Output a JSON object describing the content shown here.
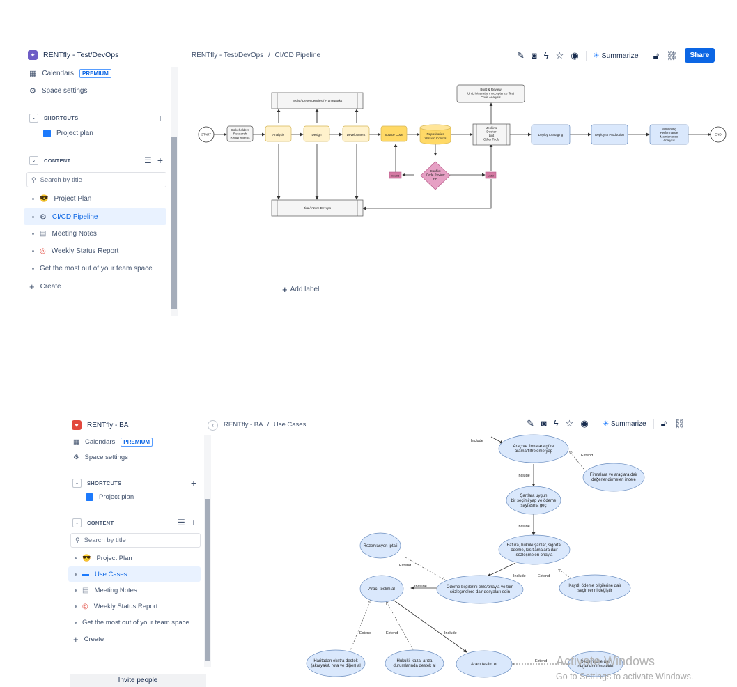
{
  "top": {
    "space_title": "RENTfly - Test/DevOps",
    "sidebar": {
      "calendars": "Calendars",
      "premium": "PREMIUM",
      "space_settings": "Space settings",
      "shortcuts": "SHORTCUTS",
      "project_plan_shortcut": "Project plan",
      "content": "CONTENT",
      "search_placeholder": "Search by title",
      "items": [
        "Project Plan",
        "CI/CD Pipeline",
        "Meeting Notes",
        "Weekly Status Report",
        "Get the most out of your team space"
      ],
      "create": "Create"
    },
    "breadcrumb": {
      "space": "RENTfly - Test/DevOps",
      "sep": "/",
      "page": "CI/CD Pipeline"
    },
    "toolbar": {
      "summarize": "Summarize",
      "share": "Share"
    },
    "add_label": "Add label",
    "diagram": {
      "start": "START",
      "end": "END",
      "stakeholders": [
        "Stakeholders",
        "Research",
        "Requirements"
      ],
      "analysis": "Analysis",
      "design": "Design",
      "development": "Development",
      "source_code": "Source Code",
      "repositories": [
        "Repositories",
        "Version Control"
      ],
      "jenkins": [
        "Jenkins",
        "Docker",
        "Lint",
        "Other Tools"
      ],
      "deploy_staging": "Deploy to Staging",
      "deploy_production": "Deploy to Production",
      "monitoring": [
        "Monitoring",
        "Performance",
        "Maintenance",
        "Analysis"
      ],
      "tools": "Tools / Dependencies / Frameworks",
      "jira": "Jira / Azure Devops",
      "build_review": [
        "Build & Review",
        "Unit, Integration, Acceptance Test",
        "Code Analysis"
      ],
      "conflict": [
        "Conflict",
        "Code Review",
        "PR"
      ],
      "invalid": "invalid",
      "valid": "valid"
    }
  },
  "bottom": {
    "space_title": "RENTfly - BA",
    "sidebar": {
      "calendars": "Calendars",
      "premium": "PREMIUM",
      "space_settings": "Space settings",
      "shortcuts": "SHORTCUTS",
      "project_plan_shortcut": "Project plan",
      "content": "CONTENT",
      "search_placeholder": "Search by title",
      "items": [
        "Project Plan",
        "Use Cases",
        "Meeting Notes",
        "Weekly Status Report",
        "Get the most out of your team space"
      ],
      "create": "Create",
      "invite": "Invite people"
    },
    "breadcrumb": {
      "space": "RENTfly - BA",
      "sep": "/",
      "page": "Use Cases"
    },
    "toolbar": {
      "summarize": "Summarize"
    },
    "diagram": {
      "include_top": "Include",
      "search_filter": [
        "Araç ve firmalara göre",
        "arama/filtreleme yap"
      ],
      "extend1": "Extend",
      "reviews": [
        "Firmalara ve araçlara dair",
        "değerlendirmeleri incele"
      ],
      "include2": "Include",
      "select": [
        "Şartlara uygun",
        "bir seçimi yap ve ödeme",
        "sayfasına geç"
      ],
      "include3": "Include",
      "invoice": [
        "Fatura, hukuki şartlar, sigorta,",
        "ödeme, kısıtlamalara dair",
        "sözleşmeleri onayla"
      ],
      "reservation_cancel": "Rezervasyon iptali",
      "extend_cancel": "Extend",
      "include4": "Include",
      "extend4": "Extend",
      "payment": [
        "Ödeme bilgilerini ekle/onayla ve tüm",
        "sözleşmelere dair dosyaları edin"
      ],
      "saved_payment": [
        "Kayıtlı ödeme bilgilerine dair",
        "seçimlerini değiştir"
      ],
      "include5": "Include",
      "receive_car": "Aracı teslim al",
      "include6": "Include",
      "extend5": "Extend",
      "extend6": "Extend",
      "map_support": [
        "Haritadan ekstra destek",
        "(akaryakıt, rota ve diğer) al"
      ],
      "legal_support": [
        "Hukuki, kaza, arıza",
        "durumlarında destek al"
      ],
      "return_car": "Aracı teslim et",
      "extend7": "Extend",
      "rate": [
        "Deneyimine dair",
        "değerlendirme ekle"
      ]
    }
  },
  "watermark": {
    "line1": "Activate Windows",
    "line2": "Go to Settings to activate Windows."
  }
}
